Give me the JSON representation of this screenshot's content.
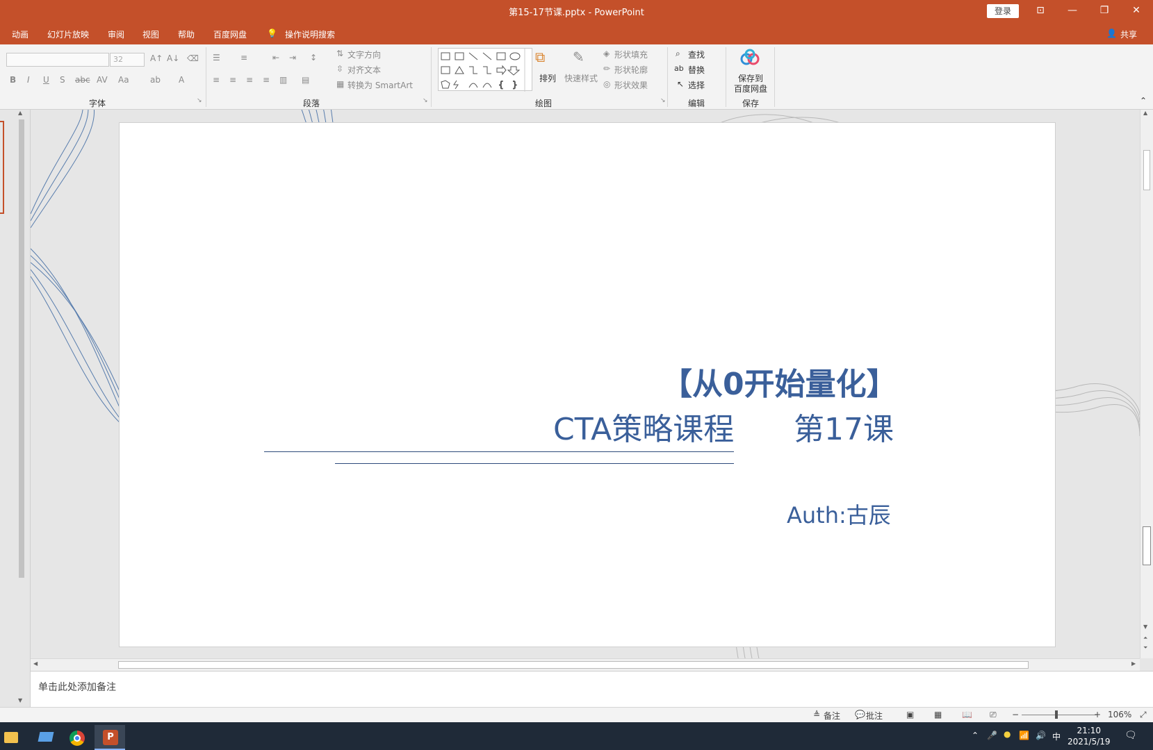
{
  "window": {
    "title": "第15-17节课.pptx  -  PowerPoint",
    "login_label": "登录",
    "share_label": "共享"
  },
  "menu": {
    "items": [
      "动画",
      "幻灯片放映",
      "审阅",
      "视图",
      "帮助",
      "百度网盘"
    ],
    "search_label": "操作说明搜索"
  },
  "ribbon": {
    "font_size_value": "32",
    "groups": {
      "font": "字体",
      "paragraph": "段落",
      "drawing": "绘图",
      "editing": "编辑",
      "save": "保存"
    },
    "paragraph": {
      "text_direction": "文字方向",
      "align_text": "对齐文本",
      "convert_smartart": "转换为 SmartArt"
    },
    "drawing": {
      "arrange": "排列",
      "quick_styles": "快速样式",
      "shape_fill": "形状填充",
      "shape_outline": "形状轮廓",
      "shape_effects": "形状效果"
    },
    "editing": {
      "find": "查找",
      "replace": "替换",
      "select": "选择"
    },
    "save": {
      "save_to_baidu": "保存到",
      "save_to_baidu_2": "百度网盘"
    }
  },
  "slide": {
    "title": "【从0开始量化】",
    "subtitle_left": "CTA策略课程",
    "subtitle_right": "第17课",
    "author": "Auth:古辰"
  },
  "notes": {
    "placeholder": "单击此处添加备注"
  },
  "status": {
    "notes_label": "备注",
    "comments_label": "批注",
    "zoom": "106%"
  },
  "taskbar": {
    "time": "21:10",
    "date": "2021/5/19",
    "ime": "中"
  },
  "colors": {
    "accent": "#c4502a",
    "slide_text": "#3a5f9a"
  }
}
